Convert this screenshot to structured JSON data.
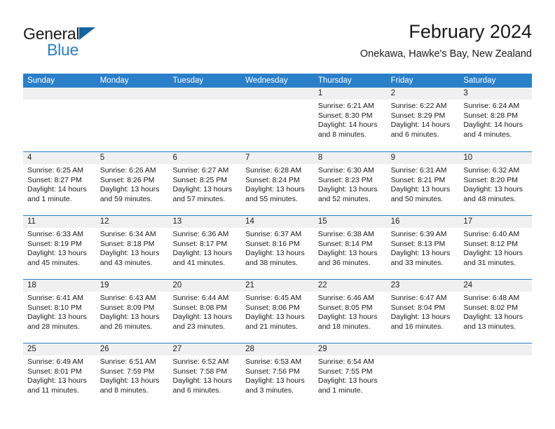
{
  "brand": {
    "name_part1": "General",
    "name_part2": "Blue",
    "triangle_icon": "triangle-icon"
  },
  "header": {
    "title": "February 2024",
    "subtitle": "Onekawa, Hawke's Bay, New Zealand"
  },
  "colors": {
    "accent_blue": "#2a7fc9",
    "logo_blue": "#1264a3",
    "day_band": "#f0f0f0",
    "text": "#1a1a1a"
  },
  "weekdays": [
    "Sunday",
    "Monday",
    "Tuesday",
    "Wednesday",
    "Thursday",
    "Friday",
    "Saturday"
  ],
  "weeks": [
    [
      {
        "day": "",
        "lines": []
      },
      {
        "day": "",
        "lines": []
      },
      {
        "day": "",
        "lines": []
      },
      {
        "day": "",
        "lines": []
      },
      {
        "day": "1",
        "lines": [
          "Sunrise: 6:21 AM",
          "Sunset: 8:30 PM",
          "Daylight: 14 hours",
          "and 8 minutes."
        ]
      },
      {
        "day": "2",
        "lines": [
          "Sunrise: 6:22 AM",
          "Sunset: 8:29 PM",
          "Daylight: 14 hours",
          "and 6 minutes."
        ]
      },
      {
        "day": "3",
        "lines": [
          "Sunrise: 6:24 AM",
          "Sunset: 8:28 PM",
          "Daylight: 14 hours",
          "and 4 minutes."
        ]
      }
    ],
    [
      {
        "day": "4",
        "lines": [
          "Sunrise: 6:25 AM",
          "Sunset: 8:27 PM",
          "Daylight: 14 hours",
          "and 1 minute."
        ]
      },
      {
        "day": "5",
        "lines": [
          "Sunrise: 6:26 AM",
          "Sunset: 8:26 PM",
          "Daylight: 13 hours",
          "and 59 minutes."
        ]
      },
      {
        "day": "6",
        "lines": [
          "Sunrise: 6:27 AM",
          "Sunset: 8:25 PM",
          "Daylight: 13 hours",
          "and 57 minutes."
        ]
      },
      {
        "day": "7",
        "lines": [
          "Sunrise: 6:28 AM",
          "Sunset: 8:24 PM",
          "Daylight: 13 hours",
          "and 55 minutes."
        ]
      },
      {
        "day": "8",
        "lines": [
          "Sunrise: 6:30 AM",
          "Sunset: 8:23 PM",
          "Daylight: 13 hours",
          "and 52 minutes."
        ]
      },
      {
        "day": "9",
        "lines": [
          "Sunrise: 6:31 AM",
          "Sunset: 8:21 PM",
          "Daylight: 13 hours",
          "and 50 minutes."
        ]
      },
      {
        "day": "10",
        "lines": [
          "Sunrise: 6:32 AM",
          "Sunset: 8:20 PM",
          "Daylight: 13 hours",
          "and 48 minutes."
        ]
      }
    ],
    [
      {
        "day": "11",
        "lines": [
          "Sunrise: 6:33 AM",
          "Sunset: 8:19 PM",
          "Daylight: 13 hours",
          "and 45 minutes."
        ]
      },
      {
        "day": "12",
        "lines": [
          "Sunrise: 6:34 AM",
          "Sunset: 8:18 PM",
          "Daylight: 13 hours",
          "and 43 minutes."
        ]
      },
      {
        "day": "13",
        "lines": [
          "Sunrise: 6:36 AM",
          "Sunset: 8:17 PM",
          "Daylight: 13 hours",
          "and 41 minutes."
        ]
      },
      {
        "day": "14",
        "lines": [
          "Sunrise: 6:37 AM",
          "Sunset: 8:16 PM",
          "Daylight: 13 hours",
          "and 38 minutes."
        ]
      },
      {
        "day": "15",
        "lines": [
          "Sunrise: 6:38 AM",
          "Sunset: 8:14 PM",
          "Daylight: 13 hours",
          "and 36 minutes."
        ]
      },
      {
        "day": "16",
        "lines": [
          "Sunrise: 6:39 AM",
          "Sunset: 8:13 PM",
          "Daylight: 13 hours",
          "and 33 minutes."
        ]
      },
      {
        "day": "17",
        "lines": [
          "Sunrise: 6:40 AM",
          "Sunset: 8:12 PM",
          "Daylight: 13 hours",
          "and 31 minutes."
        ]
      }
    ],
    [
      {
        "day": "18",
        "lines": [
          "Sunrise: 6:41 AM",
          "Sunset: 8:10 PM",
          "Daylight: 13 hours",
          "and 28 minutes."
        ]
      },
      {
        "day": "19",
        "lines": [
          "Sunrise: 6:43 AM",
          "Sunset: 8:09 PM",
          "Daylight: 13 hours",
          "and 26 minutes."
        ]
      },
      {
        "day": "20",
        "lines": [
          "Sunrise: 6:44 AM",
          "Sunset: 8:08 PM",
          "Daylight: 13 hours",
          "and 23 minutes."
        ]
      },
      {
        "day": "21",
        "lines": [
          "Sunrise: 6:45 AM",
          "Sunset: 8:06 PM",
          "Daylight: 13 hours",
          "and 21 minutes."
        ]
      },
      {
        "day": "22",
        "lines": [
          "Sunrise: 6:46 AM",
          "Sunset: 8:05 PM",
          "Daylight: 13 hours",
          "and 18 minutes."
        ]
      },
      {
        "day": "23",
        "lines": [
          "Sunrise: 6:47 AM",
          "Sunset: 8:04 PM",
          "Daylight: 13 hours",
          "and 16 minutes."
        ]
      },
      {
        "day": "24",
        "lines": [
          "Sunrise: 6:48 AM",
          "Sunset: 8:02 PM",
          "Daylight: 13 hours",
          "and 13 minutes."
        ]
      }
    ],
    [
      {
        "day": "25",
        "lines": [
          "Sunrise: 6:49 AM",
          "Sunset: 8:01 PM",
          "Daylight: 13 hours",
          "and 11 minutes."
        ]
      },
      {
        "day": "26",
        "lines": [
          "Sunrise: 6:51 AM",
          "Sunset: 7:59 PM",
          "Daylight: 13 hours",
          "and 8 minutes."
        ]
      },
      {
        "day": "27",
        "lines": [
          "Sunrise: 6:52 AM",
          "Sunset: 7:58 PM",
          "Daylight: 13 hours",
          "and 6 minutes."
        ]
      },
      {
        "day": "28",
        "lines": [
          "Sunrise: 6:53 AM",
          "Sunset: 7:56 PM",
          "Daylight: 13 hours",
          "and 3 minutes."
        ]
      },
      {
        "day": "29",
        "lines": [
          "Sunrise: 6:54 AM",
          "Sunset: 7:55 PM",
          "Daylight: 13 hours",
          "and 1 minute."
        ]
      },
      {
        "day": "",
        "lines": []
      },
      {
        "day": "",
        "lines": []
      }
    ]
  ]
}
